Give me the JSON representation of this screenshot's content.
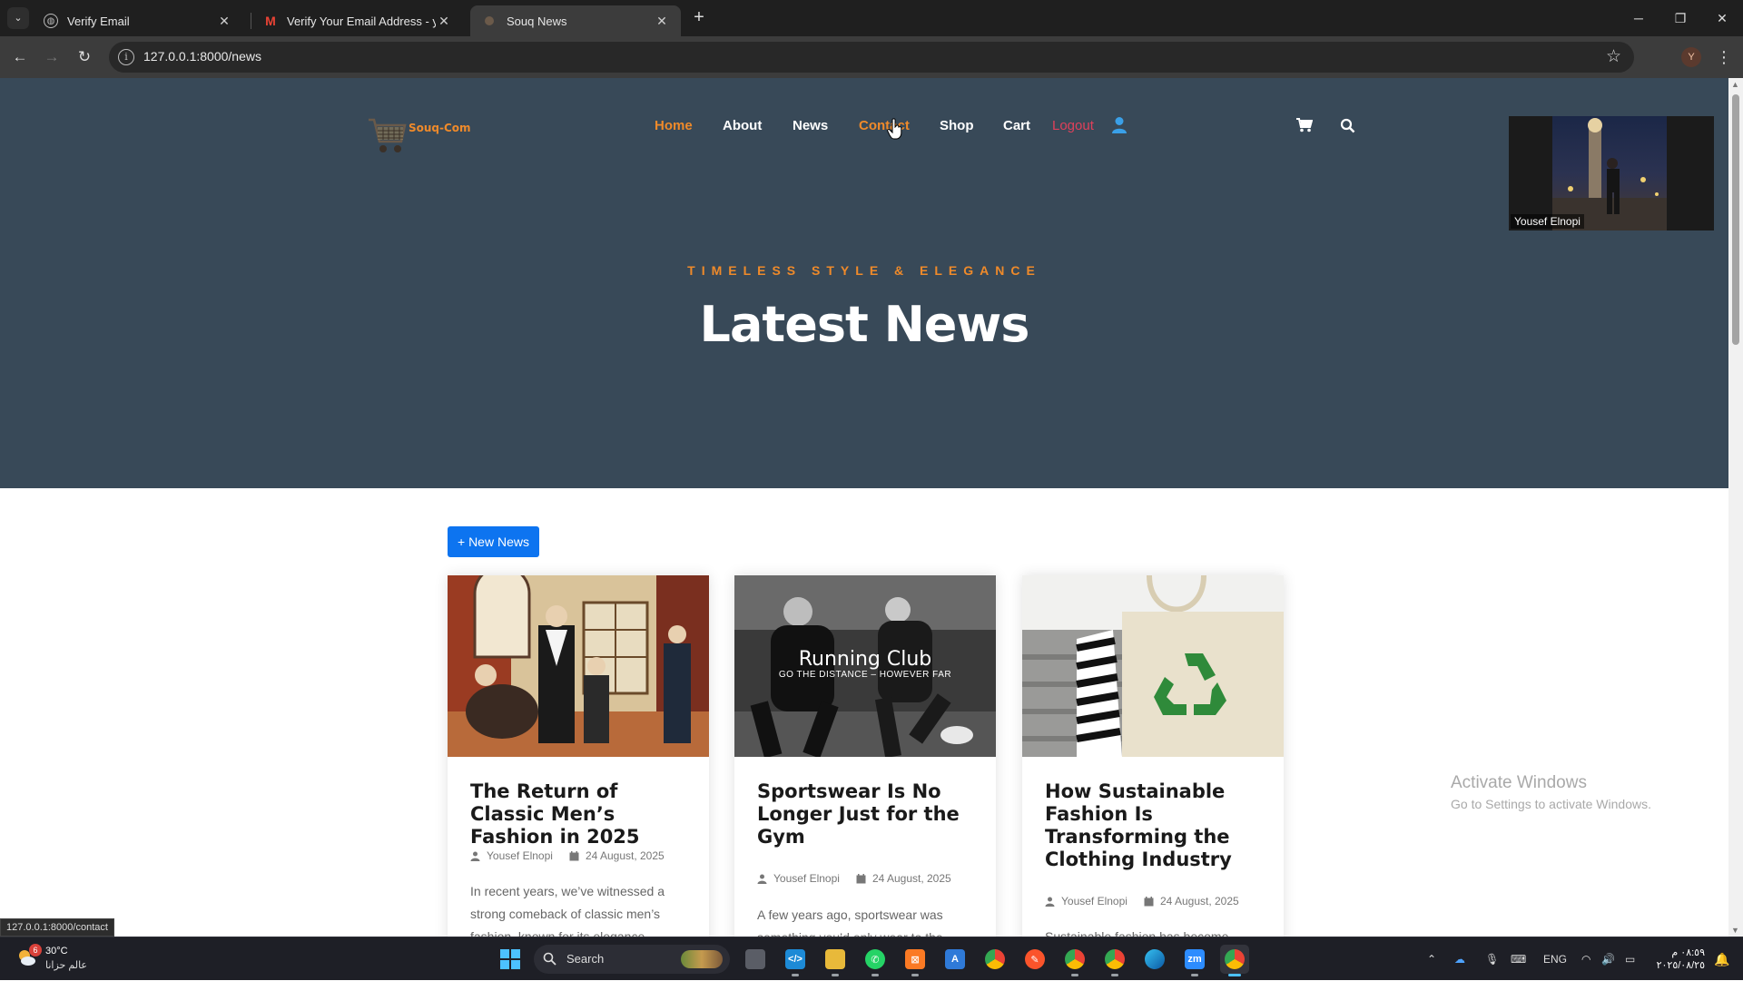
{
  "browser": {
    "tabs": [
      {
        "title": "Verify Email",
        "icon": "globe-icon",
        "active": false
      },
      {
        "title": "Verify Your Email Address - you",
        "icon": "gmail-icon",
        "active": false
      },
      {
        "title": "Souq News",
        "icon": "site-favicon",
        "active": true
      }
    ],
    "url": "127.0.0.1:8000/news",
    "profile_initial": "Y",
    "status_url": "127.0.0.1:8000/contact"
  },
  "site": {
    "logo_text": "Souq-Com",
    "nav": [
      {
        "label": "Home",
        "state": "active"
      },
      {
        "label": "About",
        "state": "normal"
      },
      {
        "label": "News",
        "state": "normal"
      },
      {
        "label": "Contact",
        "state": "hover"
      },
      {
        "label": "Shop",
        "state": "normal"
      },
      {
        "label": "Cart",
        "state": "normal"
      },
      {
        "label": "Logout",
        "state": "logout"
      }
    ],
    "hero": {
      "overline": "TIMELESS STYLE & ELEGANCE",
      "title": "Latest News"
    },
    "new_news_button": "+ New News",
    "cards": [
      {
        "title": "The Return of Classic Men’s Fashion in 2025",
        "author": "Yousef Elnopi",
        "date": "24 August, 2025",
        "excerpt": "In recent years, we’ve witnessed a strong comeback of classic men’s fashion, known for its elegance"
      },
      {
        "title": "Sportswear Is No Longer Just for the Gym",
        "author": "Yousef Elnopi",
        "date": "24 August, 2025",
        "excerpt": "A few years ago, sportswear was something you’d only wear to the",
        "image_text": {
          "headline": "Running Club",
          "sub": "GO THE DISTANCE – HOWEVER FAR"
        }
      },
      {
        "title": "How Sustainable Fashion Is Transforming the Clothing Industry",
        "author": "Yousef Elnopi",
        "date": "24 August, 2025",
        "excerpt": "Sustainable fashion has become"
      }
    ]
  },
  "video_overlay": {
    "name": "Yousef Elnopi"
  },
  "windows_watermark": {
    "line1": "Activate Windows",
    "line2": "Go to Settings to activate Windows."
  },
  "taskbar": {
    "weather_temp": "30°C",
    "weather_desc": "عالم حزانا",
    "weather_badge": "6",
    "search_label": "Search",
    "apps": [
      "task-view",
      "vscode",
      "file-explorer",
      "whatsapp",
      "xampp",
      "word-a",
      "chrome",
      "brave",
      "chrome-profile",
      "chrome-profile-2",
      "edge",
      "zoom",
      "chrome-active"
    ],
    "lang": "ENG",
    "time": "٠٨:٥٩ م",
    "date": "٢٠٢٥/٠٨/٢٥"
  },
  "colors": {
    "hero_bg": "#384958",
    "accent": "#ef8a2a",
    "logout": "#e0405a",
    "button_blue": "#0d74f0"
  }
}
